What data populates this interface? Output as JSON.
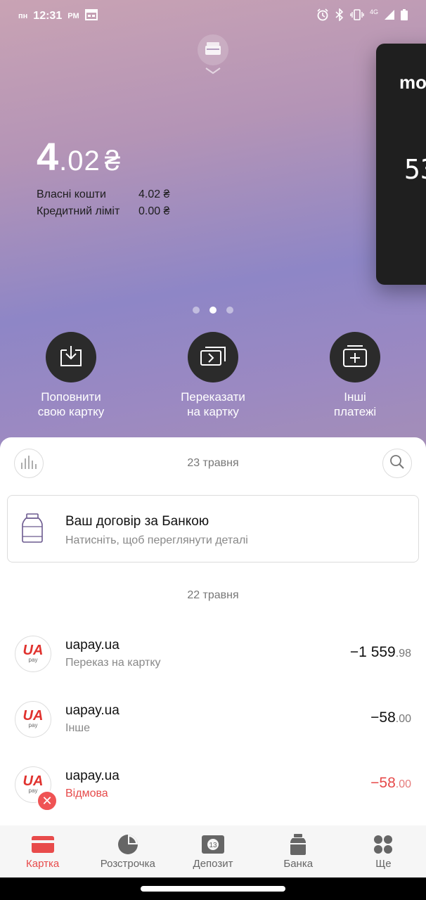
{
  "status_bar": {
    "day": "пн",
    "time": "12:31",
    "ampm": "PM",
    "network": "4G"
  },
  "balance": {
    "integer": "4",
    "decimal": ".02",
    "currency": "₴",
    "own_funds_label": "Власні кошти",
    "own_funds_value": "4.02 ₴",
    "credit_limit_label": "Кредитний ліміт",
    "credit_limit_value": "0.00 ₴"
  },
  "side_card": {
    "brand": "mo",
    "number_fragment": "53"
  },
  "pager": {
    "count": 3,
    "active": 1
  },
  "actions": [
    {
      "label": "Поповнити\nсвою картку",
      "icon": "top-up-icon"
    },
    {
      "label": "Переказати\nна картку",
      "icon": "transfer-icon"
    },
    {
      "label": "Інші\nплатежі",
      "icon": "other-payments-icon"
    }
  ],
  "feed": {
    "date_1": "23 травня",
    "contract": {
      "title": "Ваш договір за Банкою",
      "subtitle": "Натисніть, щоб переглянути деталі"
    },
    "date_2": "22 травня",
    "transactions": [
      {
        "name": "uapay.ua",
        "description": "Переказ на картку",
        "amount_main": "−1 559",
        "amount_cents": ".98",
        "declined": false
      },
      {
        "name": "uapay.ua",
        "description": "Інше",
        "amount_main": "−58",
        "amount_cents": ".00",
        "declined": false
      },
      {
        "name": "uapay.ua",
        "description": "Відмова",
        "amount_main": "−58",
        "amount_cents": ".00",
        "declined": true
      }
    ],
    "logo_text": "UA",
    "logo_subtext": "pay"
  },
  "bottom_nav": [
    {
      "label": "Картка",
      "active": true
    },
    {
      "label": "Розстрочка",
      "active": false
    },
    {
      "label": "Депозит",
      "active": false
    },
    {
      "label": "Банка",
      "active": false
    },
    {
      "label": "Ще",
      "active": false
    }
  ],
  "colors": {
    "accent_red": "#e84b4b",
    "declined_red": "#e64a4a",
    "card_dark": "#1f1f1f",
    "action_circle": "#2b2b2b"
  }
}
